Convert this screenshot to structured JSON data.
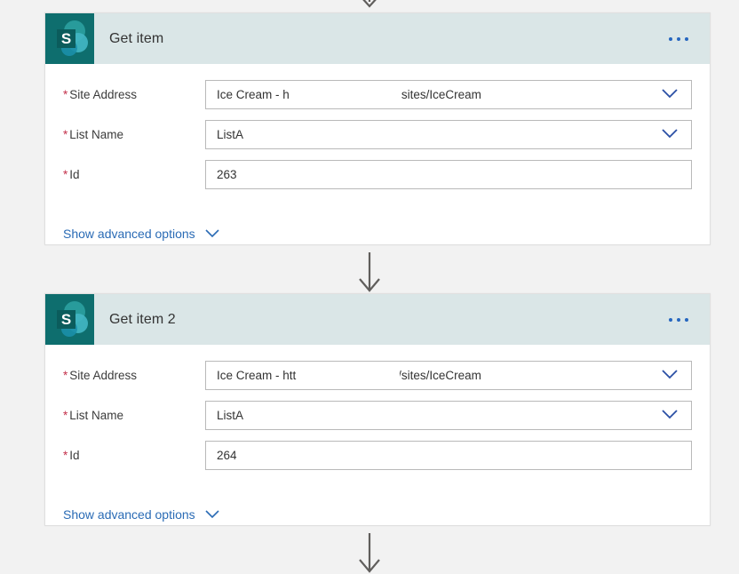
{
  "page": {
    "background_color": "#f2f2f2",
    "app": "Power Automate flow designer"
  },
  "colors": {
    "card_header_bg": "#dae6e7",
    "icon_bg": "#0e6e6e",
    "accent_link": "#2a6bb5",
    "required_asterisk": "#c4314b",
    "chevron": "#2a4fa5",
    "menu_dot": "#2666bf",
    "arrow": "#605e5c",
    "card_border": "#e0e0e0",
    "input_border": "#b9b9b9"
  },
  "connectors": [
    {
      "name": "connector-top",
      "partial": true,
      "direction": "down"
    },
    {
      "name": "connector-middle",
      "partial": false,
      "direction": "down"
    },
    {
      "name": "connector-bottom",
      "partial": true,
      "direction": "down"
    }
  ],
  "cards": [
    {
      "id": "get-item",
      "title": "Get item",
      "icon": "sharepoint-icon",
      "menu": "ellipsis-icon",
      "advanced_label": "Show advanced options",
      "advanced_chevron": "chevron-down-icon",
      "fields": [
        {
          "label": "Site Address",
          "required": true,
          "required_mark": "*",
          "value": "Ice Cream - https://                    harepoint.com/sites/IceCream",
          "control": "dropdown",
          "redacted": true,
          "chevron": "chevron-down-icon"
        },
        {
          "label": "List Name",
          "required": true,
          "required_mark": "*",
          "value": "ListA",
          "control": "dropdown",
          "redacted": false,
          "chevron": "chevron-down-icon"
        },
        {
          "label": "Id",
          "required": true,
          "required_mark": "*",
          "value": "263",
          "control": "textbox",
          "redacted": false,
          "chevron": null
        }
      ]
    },
    {
      "id": "get-item-2",
      "title": "Get item 2",
      "icon": "sharepoint-icon",
      "menu": "ellipsis-icon",
      "advanced_label": "Show advanced options",
      "advanced_chevron": "chevron-down-icon",
      "fields": [
        {
          "label": "Site Address",
          "required": true,
          "required_mark": "*",
          "value": "Ice Cream - https://                  harepoint.com/sites/IceCream",
          "control": "dropdown",
          "redacted": true,
          "chevron": "chevron-down-icon"
        },
        {
          "label": "List Name",
          "required": true,
          "required_mark": "*",
          "value": "ListA",
          "control": "dropdown",
          "redacted": false,
          "chevron": "chevron-down-icon"
        },
        {
          "label": "Id",
          "required": true,
          "required_mark": "*",
          "value": "264",
          "control": "textbox",
          "redacted": false,
          "chevron": null
        }
      ]
    }
  ]
}
